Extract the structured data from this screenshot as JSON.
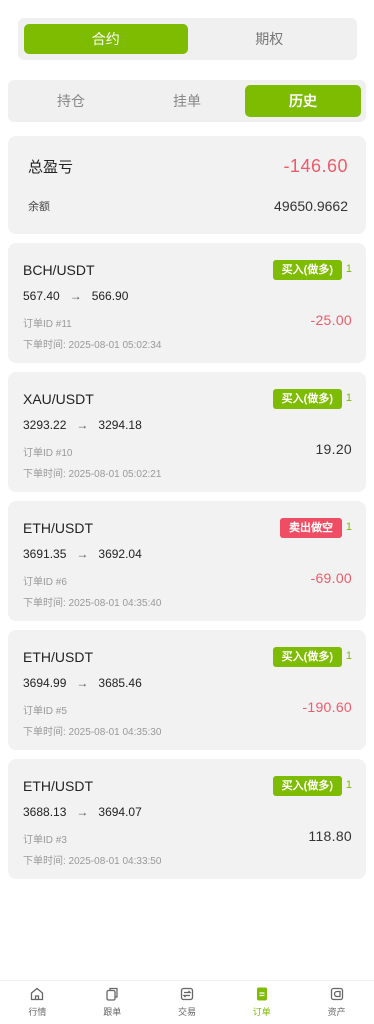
{
  "top_tabs": [
    {
      "label": "合约",
      "active": true
    },
    {
      "label": "期权",
      "active": false
    }
  ],
  "sub_tabs": [
    {
      "label": "持仓",
      "active": false
    },
    {
      "label": "挂单",
      "active": false
    },
    {
      "label": "历史",
      "active": true
    }
  ],
  "summary": {
    "total_pnl_label": "总盈亏",
    "total_pnl_value": "-146.60",
    "balance_label": "余额",
    "balance_value": "49650.9662"
  },
  "orders": [
    {
      "symbol": "BCH/USDT",
      "side": "买入(做多)",
      "side_type": "buy",
      "leverage": "1",
      "open_price": "567.40",
      "arrow": "→",
      "close_price": "566.90",
      "order_id": "订单ID #11",
      "pnl": "-25.00",
      "pnl_sign": "neg",
      "time": "下单时间: 2025-08-01 05:02:34"
    },
    {
      "symbol": "XAU/USDT",
      "side": "买入(做多)",
      "side_type": "buy",
      "leverage": "1",
      "open_price": "3293.22",
      "arrow": "→",
      "close_price": "3294.18",
      "order_id": "订单ID #10",
      "pnl": "19.20",
      "pnl_sign": "pos",
      "time": "下单时间: 2025-08-01 05:02:21"
    },
    {
      "symbol": "ETH/USDT",
      "side": "卖出做空",
      "side_type": "sell",
      "leverage": "1",
      "open_price": "3691.35",
      "arrow": "→",
      "close_price": "3692.04",
      "order_id": "订单ID #6",
      "pnl": "-69.00",
      "pnl_sign": "neg",
      "time": "下单时间: 2025-08-01 04:35:40"
    },
    {
      "symbol": "ETH/USDT",
      "side": "买入(做多)",
      "side_type": "buy",
      "leverage": "1",
      "open_price": "3694.99",
      "arrow": "→",
      "close_price": "3685.46",
      "order_id": "订单ID #5",
      "pnl": "-190.60",
      "pnl_sign": "neg",
      "time": "下单时间: 2025-08-01 04:35:30"
    },
    {
      "symbol": "ETH/USDT",
      "side": "买入(做多)",
      "side_type": "buy",
      "leverage": "1",
      "open_price": "3688.13",
      "arrow": "→",
      "close_price": "3694.07",
      "order_id": "订单ID #3",
      "pnl": "118.80",
      "pnl_sign": "pos",
      "time": "下单时间: 2025-08-01 04:33:50"
    }
  ],
  "bottom_nav": [
    {
      "label": "行情",
      "icon": "home-icon",
      "active": false
    },
    {
      "label": "跟单",
      "icon": "copy-icon",
      "active": false
    },
    {
      "label": "交易",
      "icon": "exchange-icon",
      "active": false
    },
    {
      "label": "订单",
      "icon": "orders-icon",
      "active": true
    },
    {
      "label": "资产",
      "icon": "wallet-icon",
      "active": false
    }
  ],
  "colors": {
    "accent": "#7dbc00",
    "negative": "#ef5b6b",
    "sell_badge": "#ee4d63",
    "card_bg": "#f2f2f2"
  }
}
